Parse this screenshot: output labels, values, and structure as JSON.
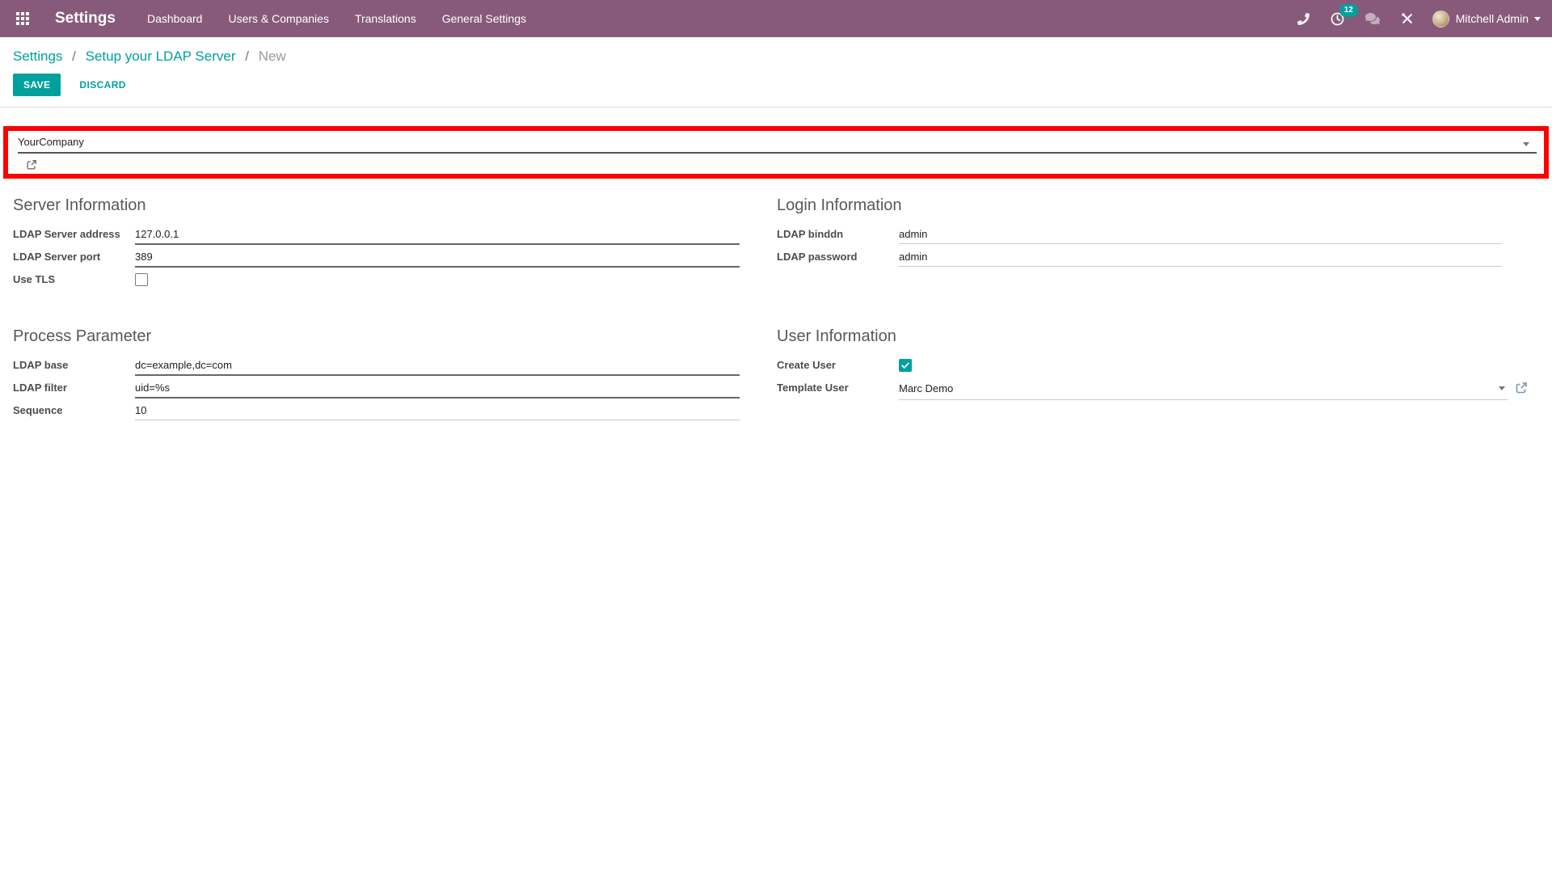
{
  "navbar": {
    "brand": "Settings",
    "menu": [
      {
        "label": "Dashboard"
      },
      {
        "label": "Users & Companies"
      },
      {
        "label": "Translations"
      },
      {
        "label": "General Settings"
      }
    ],
    "activity_badge": "12",
    "user_name": "Mitchell Admin"
  },
  "breadcrumb": {
    "link1": "Settings",
    "link2": "Setup your LDAP Server",
    "current": "New",
    "separator": "/"
  },
  "actions": {
    "save": "SAVE",
    "discard": "DISCARD"
  },
  "company_field": {
    "value": "YourCompany"
  },
  "form": {
    "server": {
      "title": "Server Information",
      "address_label": "LDAP Server address",
      "address_value": "127.0.0.1",
      "port_label": "LDAP Server port",
      "port_value": "389",
      "tls_label": "Use TLS",
      "tls_checked": false
    },
    "login": {
      "title": "Login Information",
      "binddn_label": "LDAP binddn",
      "binddn_value": "admin",
      "password_label": "LDAP password",
      "password_value": "admin"
    },
    "process": {
      "title": "Process Parameter",
      "base_label": "LDAP base",
      "base_value": "dc=example,dc=com",
      "filter_label": "LDAP filter",
      "filter_value": "uid=%s",
      "sequence_label": "Sequence",
      "sequence_value": "10"
    },
    "user": {
      "title": "User Information",
      "create_label": "Create User",
      "create_checked": true,
      "template_label": "Template User",
      "template_value": "Marc Demo"
    }
  },
  "colors": {
    "brand_purple": "#875A7B",
    "accent_teal": "#00A09D",
    "highlight_red": "#FF0000"
  }
}
